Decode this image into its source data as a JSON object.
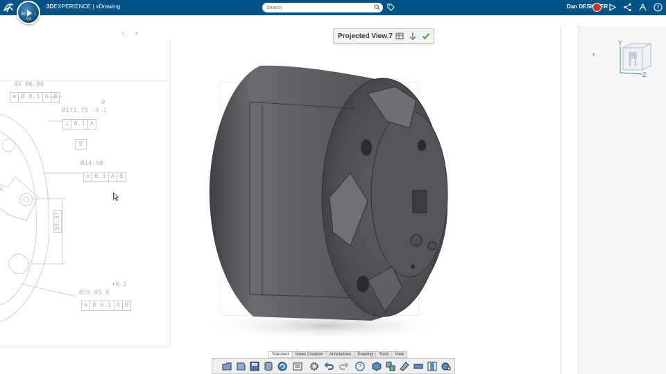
{
  "header": {
    "brand": "3D",
    "brand_suffix": "EXPERIENCE",
    "app_separator": " | ",
    "app_name": "xDrawing",
    "compass_version": "V.6",
    "search_placeholder": "Search",
    "user_name": "Dan DESIGNER"
  },
  "view_box": {
    "label": "Projected View.7"
  },
  "drawing_annotations": {
    "dim1": "4X Ø6.86",
    "fcf1": [
      "⊕",
      "Ø 0.1",
      "A",
      "B"
    ],
    "tol_upper": "0",
    "dim2": "Ø174.75 -0.1",
    "fcf2": [
      "⊥",
      "0.1",
      "A"
    ],
    "datum_b": "B",
    "dim3": "Ø14.48",
    "fcf3": [
      "◎",
      "0.1",
      "A",
      "B"
    ],
    "dim4": "58.37",
    "tol_plus": "+0.2",
    "dim5": "Ø19.05  0",
    "fcf4": [
      "⊕",
      "Ø 0.1",
      "A",
      "B"
    ]
  },
  "toolbar": {
    "tabs": [
      "Standard",
      "Views Creation",
      "Annotations",
      "Drawing",
      "Tools",
      "View"
    ],
    "active_tab": "Standard",
    "expand_glyph": "ˇ"
  },
  "right_panel": {
    "axis_y": "Y",
    "axis_z": "Z"
  },
  "colors": {
    "topbar": "#005386",
    "part_body": "#5a5b5f",
    "accept_green": "#3fa535"
  }
}
